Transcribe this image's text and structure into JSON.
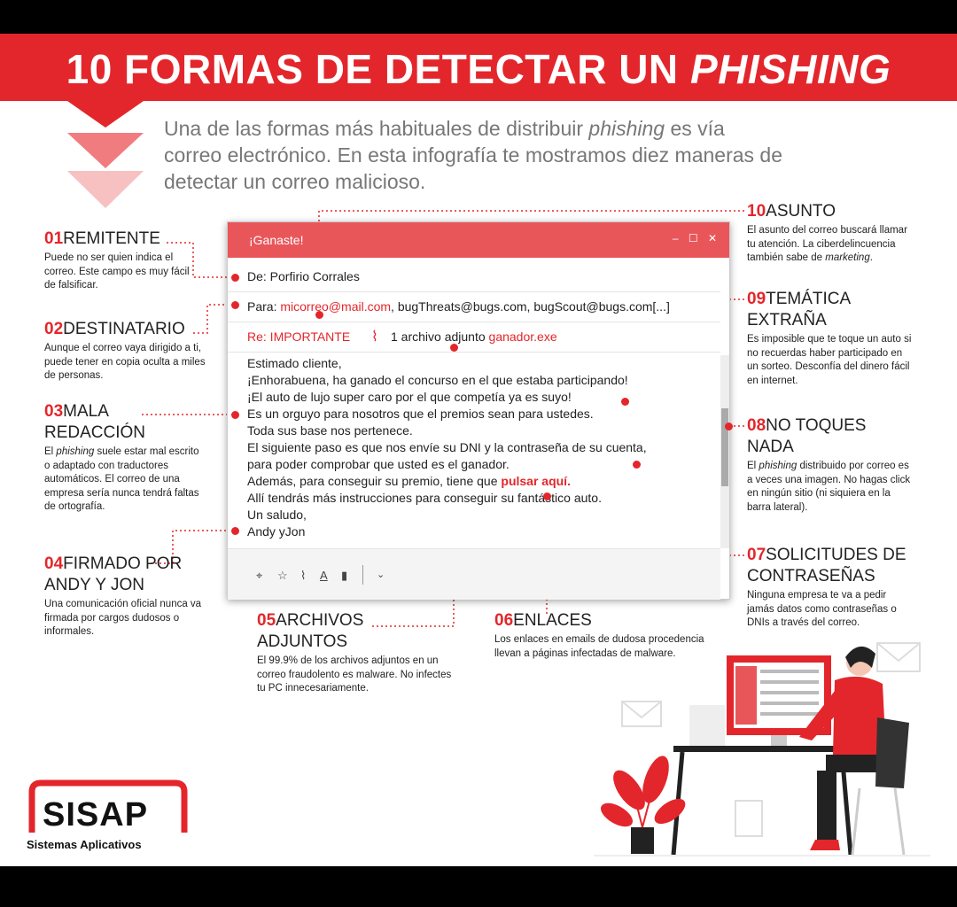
{
  "header": {
    "title_main": "10 FORMAS DE DETECTAR UN ",
    "title_emph": "PHISHING"
  },
  "intro": {
    "part1": "Una de las formas más habituales de distribuir ",
    "emph": "phishing",
    "part2": " es vía correo electrónico. En esta infografía te mostramos diez maneras de detectar un correo malicioso."
  },
  "tips": [
    {
      "num": "01",
      "head": "REMITENTE",
      "desc": "Puede no ser quien indica el correo. Este campo es muy fácil de falsificar."
    },
    {
      "num": "02",
      "head": "DESTINATARIO",
      "desc": "Aunque el correo vaya dirigido a ti, puede tener en copia oculta a miles de personas."
    },
    {
      "num": "03",
      "head": "MALA REDACCIÓN",
      "desc_a": "El ",
      "desc_em": "phishing",
      "desc_b": " suele estar mal escrito o adaptado con traductores automáticos. El correo de una empresa sería nunca tendrá faltas de ortografía."
    },
    {
      "num": "04",
      "head": "FIRMADO POR ANDY Y JON",
      "desc": "Una comunicación oficial nunca va firmada por cargos dudosos o informales."
    },
    {
      "num": "05",
      "head": "ARCHIVOS ADJUNTOS",
      "desc": "El 99.9% de los archivos adjuntos en un correo fraudolento es malware. No infectes tu PC innecesariamente."
    },
    {
      "num": "06",
      "head": "ENLACES",
      "desc": "Los enlaces en emails de dudosa procedencia llevan a páginas infectadas de malware."
    },
    {
      "num": "07",
      "head": "SOLICITUDES DE CONTRASEÑAS",
      "desc": "Ninguna empresa te va a pedir jamás datos como contraseñas o DNIs a través del correo."
    },
    {
      "num": "08",
      "head": "NO TOQUES NADA",
      "desc_a": "El ",
      "desc_em": "phishing",
      "desc_b": " distribuido por correo es a veces una imagen. No hagas click en ningún sitio (ni siquiera en la barra lateral)."
    },
    {
      "num": "09",
      "head": "TEMÁTICA EXTRAÑA",
      "desc": "Es imposible que te toque un auto si no recuerdas haber participado en un sorteo. Desconfía del dinero fácil en internet."
    },
    {
      "num": "10",
      "head": "ASUNTO",
      "desc_a": "El asunto del correo buscará llamar tu atención. La ciberdelincuencia también sabe de ",
      "desc_em": "marketing",
      "desc_b": "."
    }
  ],
  "email": {
    "window_title": "¡Ganaste!",
    "window_controls": "– ☐ ✕",
    "from_label": "De: Porfirio Corrales",
    "to_label": "Para: ",
    "to_first": "micorreo@mail.com",
    "to_rest": ", bugThreats@bugs.com, bugScout@bugs.com[...]",
    "subject": "Re: IMPORTANTE",
    "attach_text": "1 archivo adjunto ",
    "attach_file": "ganador.exe",
    "body_lines": [
      "Estimado cliente,",
      "¡Enhorabuena, ha ganado el concurso en el que estaba participando!",
      "¡El auto de lujo super caro por el que competía ya es suyo!",
      "Es un orguyo para nosotros que el premios sean para ustedes.",
      "Toda sus base nos pertenece.",
      "El siguiente paso es que nos envíe su DNI y la contraseña de su cuenta,",
      "para poder comprobar que usted es el ganador."
    ],
    "link_pre": "Además, para conseguir su premio, tiene que ",
    "link_text": "pulsar aquí.",
    "body_after": [
      "Allí tendrás más instrucciones para conseguir su fantástico auto.",
      "Un saludo,",
      "Andy yJon"
    ]
  },
  "brand": {
    "name": "SISAP",
    "tagline": "Sistemas Aplicativos"
  },
  "colors": {
    "accent": "#e3262b",
    "titlebar": "#e9565a",
    "text_gray": "#777777"
  }
}
